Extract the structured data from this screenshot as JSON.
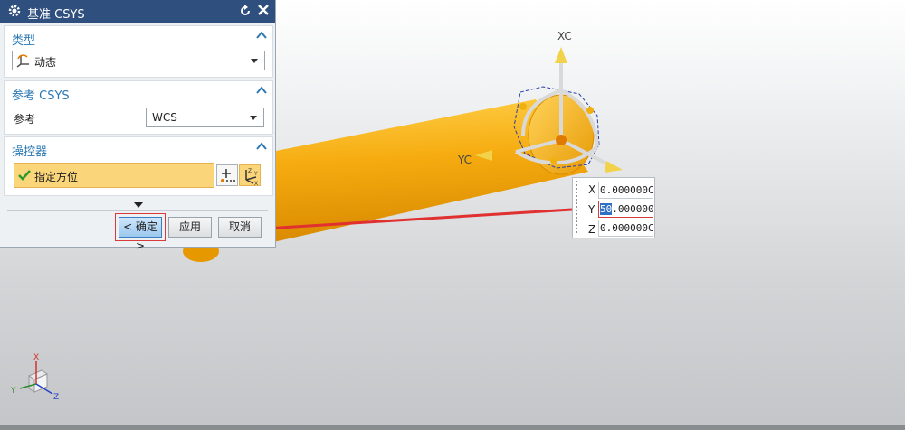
{
  "dialog": {
    "title": "基准 CSYS",
    "type_section": {
      "header": "类型",
      "selected": "动态"
    },
    "reference_section": {
      "header": "参考 CSYS",
      "label": "参考",
      "selected": "WCS"
    },
    "manipulator_section": {
      "header": "操控器",
      "item": "指定方位"
    },
    "buttons": {
      "ok": "< 确定 >",
      "apply": "应用",
      "cancel": "取消"
    }
  },
  "viewport": {
    "axis_labels": {
      "xc": "XC",
      "yc": "YC"
    },
    "triad": {
      "x": "X",
      "y": "Y",
      "z": "Z"
    }
  },
  "coordinate_input": {
    "x_label": "X",
    "x_value": "0.000000C",
    "y_label": "Y",
    "y_selected": "50",
    "y_value": ".000000C",
    "z_label": "Z",
    "z_value": "0.000000C"
  },
  "colors": {
    "title_bar": "#2f4f7e",
    "section_header": "#2c79b5",
    "highlight_row": "#fbd57a",
    "annotation": "#d83a3a",
    "cylinder": "#f7b21a"
  }
}
